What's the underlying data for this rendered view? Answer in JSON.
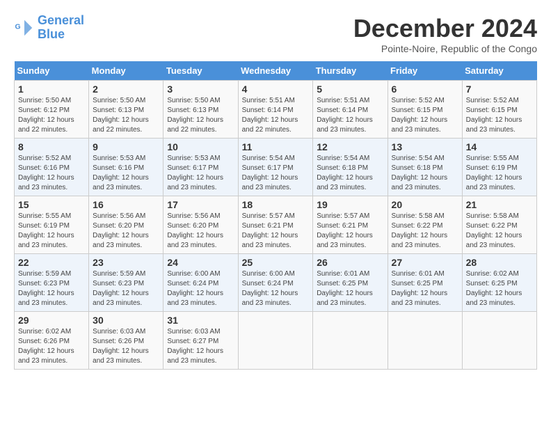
{
  "logo": {
    "line1": "General",
    "line2": "Blue"
  },
  "title": "December 2024",
  "subtitle": "Pointe-Noire, Republic of the Congo",
  "days_of_week": [
    "Sunday",
    "Monday",
    "Tuesday",
    "Wednesday",
    "Thursday",
    "Friday",
    "Saturday"
  ],
  "weeks": [
    [
      {
        "day": "1",
        "sunrise": "5:50 AM",
        "sunset": "6:12 PM",
        "daylight": "12 hours and 22 minutes."
      },
      {
        "day": "2",
        "sunrise": "5:50 AM",
        "sunset": "6:13 PM",
        "daylight": "12 hours and 22 minutes."
      },
      {
        "day": "3",
        "sunrise": "5:50 AM",
        "sunset": "6:13 PM",
        "daylight": "12 hours and 22 minutes."
      },
      {
        "day": "4",
        "sunrise": "5:51 AM",
        "sunset": "6:14 PM",
        "daylight": "12 hours and 22 minutes."
      },
      {
        "day": "5",
        "sunrise": "5:51 AM",
        "sunset": "6:14 PM",
        "daylight": "12 hours and 23 minutes."
      },
      {
        "day": "6",
        "sunrise": "5:52 AM",
        "sunset": "6:15 PM",
        "daylight": "12 hours and 23 minutes."
      },
      {
        "day": "7",
        "sunrise": "5:52 AM",
        "sunset": "6:15 PM",
        "daylight": "12 hours and 23 minutes."
      }
    ],
    [
      {
        "day": "8",
        "sunrise": "5:52 AM",
        "sunset": "6:16 PM",
        "daylight": "12 hours and 23 minutes."
      },
      {
        "day": "9",
        "sunrise": "5:53 AM",
        "sunset": "6:16 PM",
        "daylight": "12 hours and 23 minutes."
      },
      {
        "day": "10",
        "sunrise": "5:53 AM",
        "sunset": "6:17 PM",
        "daylight": "12 hours and 23 minutes."
      },
      {
        "day": "11",
        "sunrise": "5:54 AM",
        "sunset": "6:17 PM",
        "daylight": "12 hours and 23 minutes."
      },
      {
        "day": "12",
        "sunrise": "5:54 AM",
        "sunset": "6:18 PM",
        "daylight": "12 hours and 23 minutes."
      },
      {
        "day": "13",
        "sunrise": "5:54 AM",
        "sunset": "6:18 PM",
        "daylight": "12 hours and 23 minutes."
      },
      {
        "day": "14",
        "sunrise": "5:55 AM",
        "sunset": "6:19 PM",
        "daylight": "12 hours and 23 minutes."
      }
    ],
    [
      {
        "day": "15",
        "sunrise": "5:55 AM",
        "sunset": "6:19 PM",
        "daylight": "12 hours and 23 minutes."
      },
      {
        "day": "16",
        "sunrise": "5:56 AM",
        "sunset": "6:20 PM",
        "daylight": "12 hours and 23 minutes."
      },
      {
        "day": "17",
        "sunrise": "5:56 AM",
        "sunset": "6:20 PM",
        "daylight": "12 hours and 23 minutes."
      },
      {
        "day": "18",
        "sunrise": "5:57 AM",
        "sunset": "6:21 PM",
        "daylight": "12 hours and 23 minutes."
      },
      {
        "day": "19",
        "sunrise": "5:57 AM",
        "sunset": "6:21 PM",
        "daylight": "12 hours and 23 minutes."
      },
      {
        "day": "20",
        "sunrise": "5:58 AM",
        "sunset": "6:22 PM",
        "daylight": "12 hours and 23 minutes."
      },
      {
        "day": "21",
        "sunrise": "5:58 AM",
        "sunset": "6:22 PM",
        "daylight": "12 hours and 23 minutes."
      }
    ],
    [
      {
        "day": "22",
        "sunrise": "5:59 AM",
        "sunset": "6:23 PM",
        "daylight": "12 hours and 23 minutes."
      },
      {
        "day": "23",
        "sunrise": "5:59 AM",
        "sunset": "6:23 PM",
        "daylight": "12 hours and 23 minutes."
      },
      {
        "day": "24",
        "sunrise": "6:00 AM",
        "sunset": "6:24 PM",
        "daylight": "12 hours and 23 minutes."
      },
      {
        "day": "25",
        "sunrise": "6:00 AM",
        "sunset": "6:24 PM",
        "daylight": "12 hours and 23 minutes."
      },
      {
        "day": "26",
        "sunrise": "6:01 AM",
        "sunset": "6:25 PM",
        "daylight": "12 hours and 23 minutes."
      },
      {
        "day": "27",
        "sunrise": "6:01 AM",
        "sunset": "6:25 PM",
        "daylight": "12 hours and 23 minutes."
      },
      {
        "day": "28",
        "sunrise": "6:02 AM",
        "sunset": "6:25 PM",
        "daylight": "12 hours and 23 minutes."
      }
    ],
    [
      {
        "day": "29",
        "sunrise": "6:02 AM",
        "sunset": "6:26 PM",
        "daylight": "12 hours and 23 minutes."
      },
      {
        "day": "30",
        "sunrise": "6:03 AM",
        "sunset": "6:26 PM",
        "daylight": "12 hours and 23 minutes."
      },
      {
        "day": "31",
        "sunrise": "6:03 AM",
        "sunset": "6:27 PM",
        "daylight": "12 hours and 23 minutes."
      },
      null,
      null,
      null,
      null
    ]
  ]
}
